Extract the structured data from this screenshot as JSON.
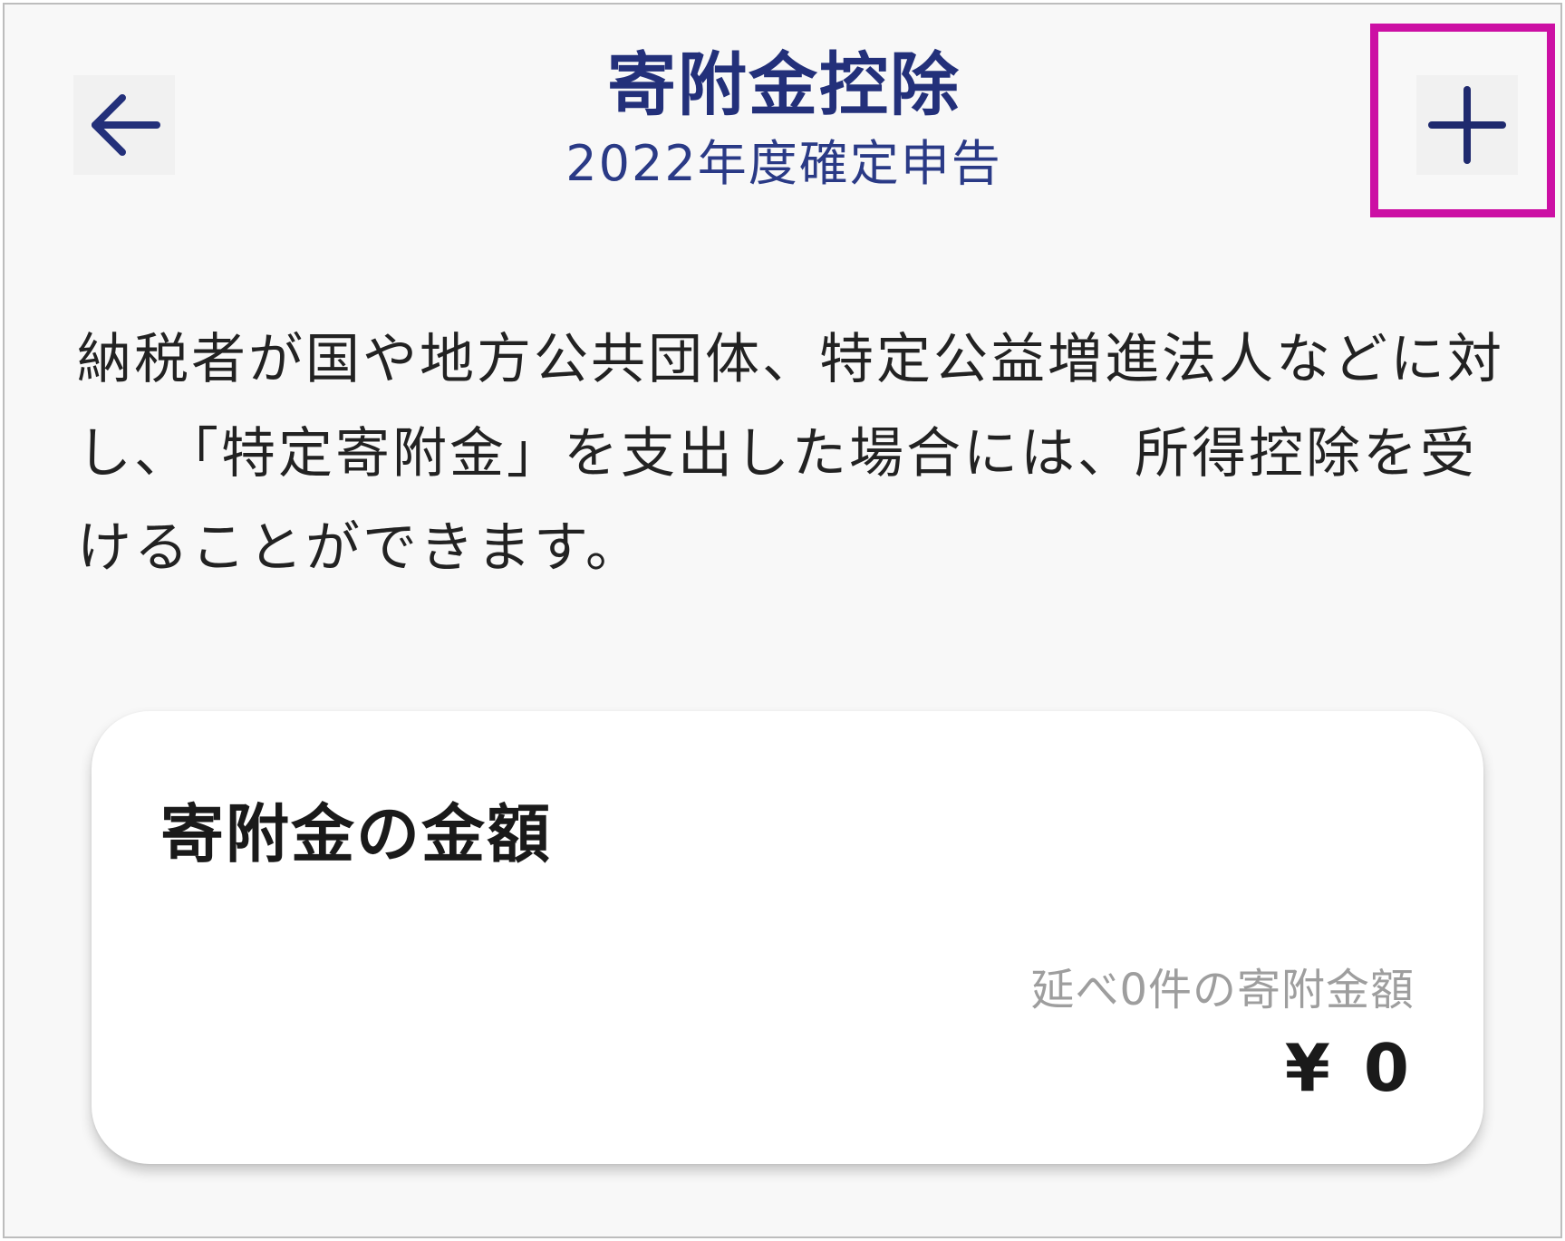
{
  "header": {
    "title": "寄附金控除",
    "subtitle": "2022年度確定申告",
    "back_icon": "arrow-left-icon",
    "add_icon": "plus-icon"
  },
  "description": "納税者が国や地方公共団体、特定公益増進法人などに対し、「特定寄附金」を支出した場合には、所得控除を受けることができます。",
  "card": {
    "title": "寄附金の金額",
    "count_label": "延べ0件の寄附金額",
    "amount": "¥ 0"
  },
  "colors": {
    "accent": "#23307a",
    "highlight": "#cc10a4",
    "background": "#f8f8f8",
    "card_background": "#ffffff",
    "muted_text": "#9e9e9e"
  }
}
